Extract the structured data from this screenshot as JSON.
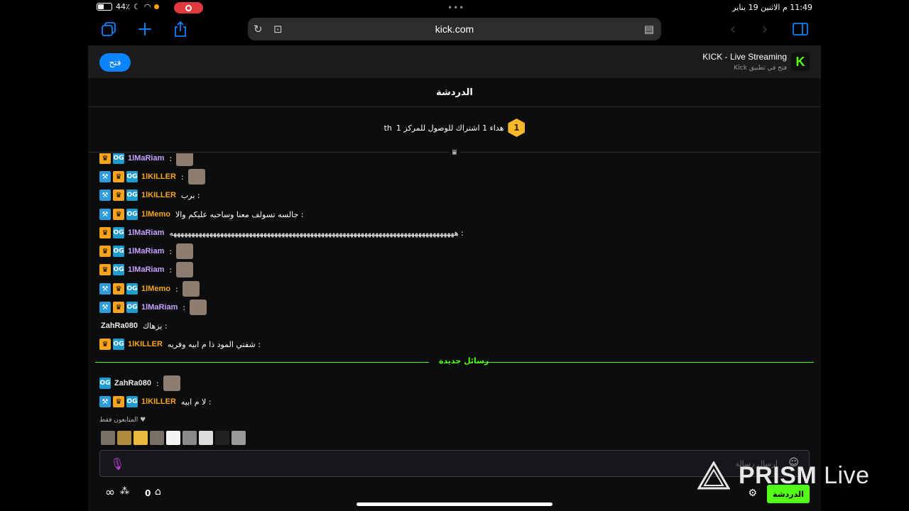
{
  "status_bar": {
    "battery": "44٪",
    "time_date": "11:49 م   الاثنين 19 يناير"
  },
  "browser": {
    "url": "kick.com"
  },
  "app_banner": {
    "open_label": "فتح",
    "title": "KICK - Live Streaming",
    "subtitle": "فتح في تطبيق Kick",
    "logo_letter": "K"
  },
  "chat": {
    "header": "الدردشة",
    "sub_goal_rank": "1",
    "sub_goal_text": "هداء 1 اشتراك للوصول للمركز 1",
    "sub_goal_suffix": "th",
    "messages": [
      {
        "user": "1lMaRiam",
        "color": "#c9a0ff",
        "badges": [
          "sub",
          "og"
        ],
        "text": ":",
        "emote": true
      },
      {
        "user": "1lKILLER",
        "color": "#f7a31b",
        "badges": [
          "mod",
          "sub",
          "og"
        ],
        "text": ":",
        "emote": true
      },
      {
        "user": "1lKILLER",
        "color": "#f7a31b",
        "badges": [
          "mod",
          "sub",
          "og"
        ],
        "text": ": برب",
        "emote": false
      },
      {
        "user": "1lMemo",
        "color": "#f7a31b",
        "badges": [
          "mod",
          "sub",
          "og"
        ],
        "text": ": جالسه تسولف معنا وساحبه عليكم والا",
        "emote": false
      },
      {
        "user": "1lMaRiam",
        "color": "#c9a0ff",
        "badges": [
          "sub",
          "og"
        ],
        "text": ": هههههههههههههههههههههههههههههههههههههههههههههههههههههههههههههههههههههههههههههههه",
        "emote": false
      },
      {
        "user": "1lMaRiam",
        "color": "#c9a0ff",
        "badges": [
          "sub",
          "og"
        ],
        "text": ":",
        "emote": true
      },
      {
        "user": "1lMaRiam",
        "color": "#c9a0ff",
        "badges": [
          "sub",
          "og"
        ],
        "text": ":",
        "emote": true
      },
      {
        "user": "1lMemo",
        "color": "#f7a31b",
        "badges": [
          "mod",
          "sub",
          "og"
        ],
        "text": ":",
        "emote": true
      },
      {
        "user": "1lMaRiam",
        "color": "#c9a0ff",
        "badges": [
          "mod",
          "sub",
          "og"
        ],
        "text": ":",
        "emote": true
      },
      {
        "user": "ZahRa080",
        "color": "#e8e8e8",
        "badges": [],
        "text": ": يزهاك",
        "emote": false
      },
      {
        "user": "1lKILLER",
        "color": "#f7a31b",
        "badges": [
          "sub",
          "og"
        ],
        "text": ": شفتي المود ذا م ابيه وفريه",
        "emote": false
      },
      {
        "user": "ZahRa080",
        "color": "#e8e8e8",
        "badges": [
          "og"
        ],
        "text": ":",
        "emote": true
      },
      {
        "user": "1lKILLER",
        "color": "#f7a31b",
        "badges": [
          "mod",
          "sub",
          "og"
        ],
        "text": ": لا م ابيه",
        "emote": false
      }
    ],
    "new_messages_label": "رسائل جديدة",
    "followers_only": "المتابعون فقط",
    "input_placeholder": "إرسال رسالة",
    "points": "0",
    "send_label": "الدردشة"
  },
  "watermark": {
    "brand": "PRISM",
    "suffix": " Live"
  },
  "colors": {
    "accent": "#53fc18",
    "safari_blue": "#0a84ff",
    "sub_badge": "#f7a31b",
    "mod_badge": "#2f9bd9"
  }
}
